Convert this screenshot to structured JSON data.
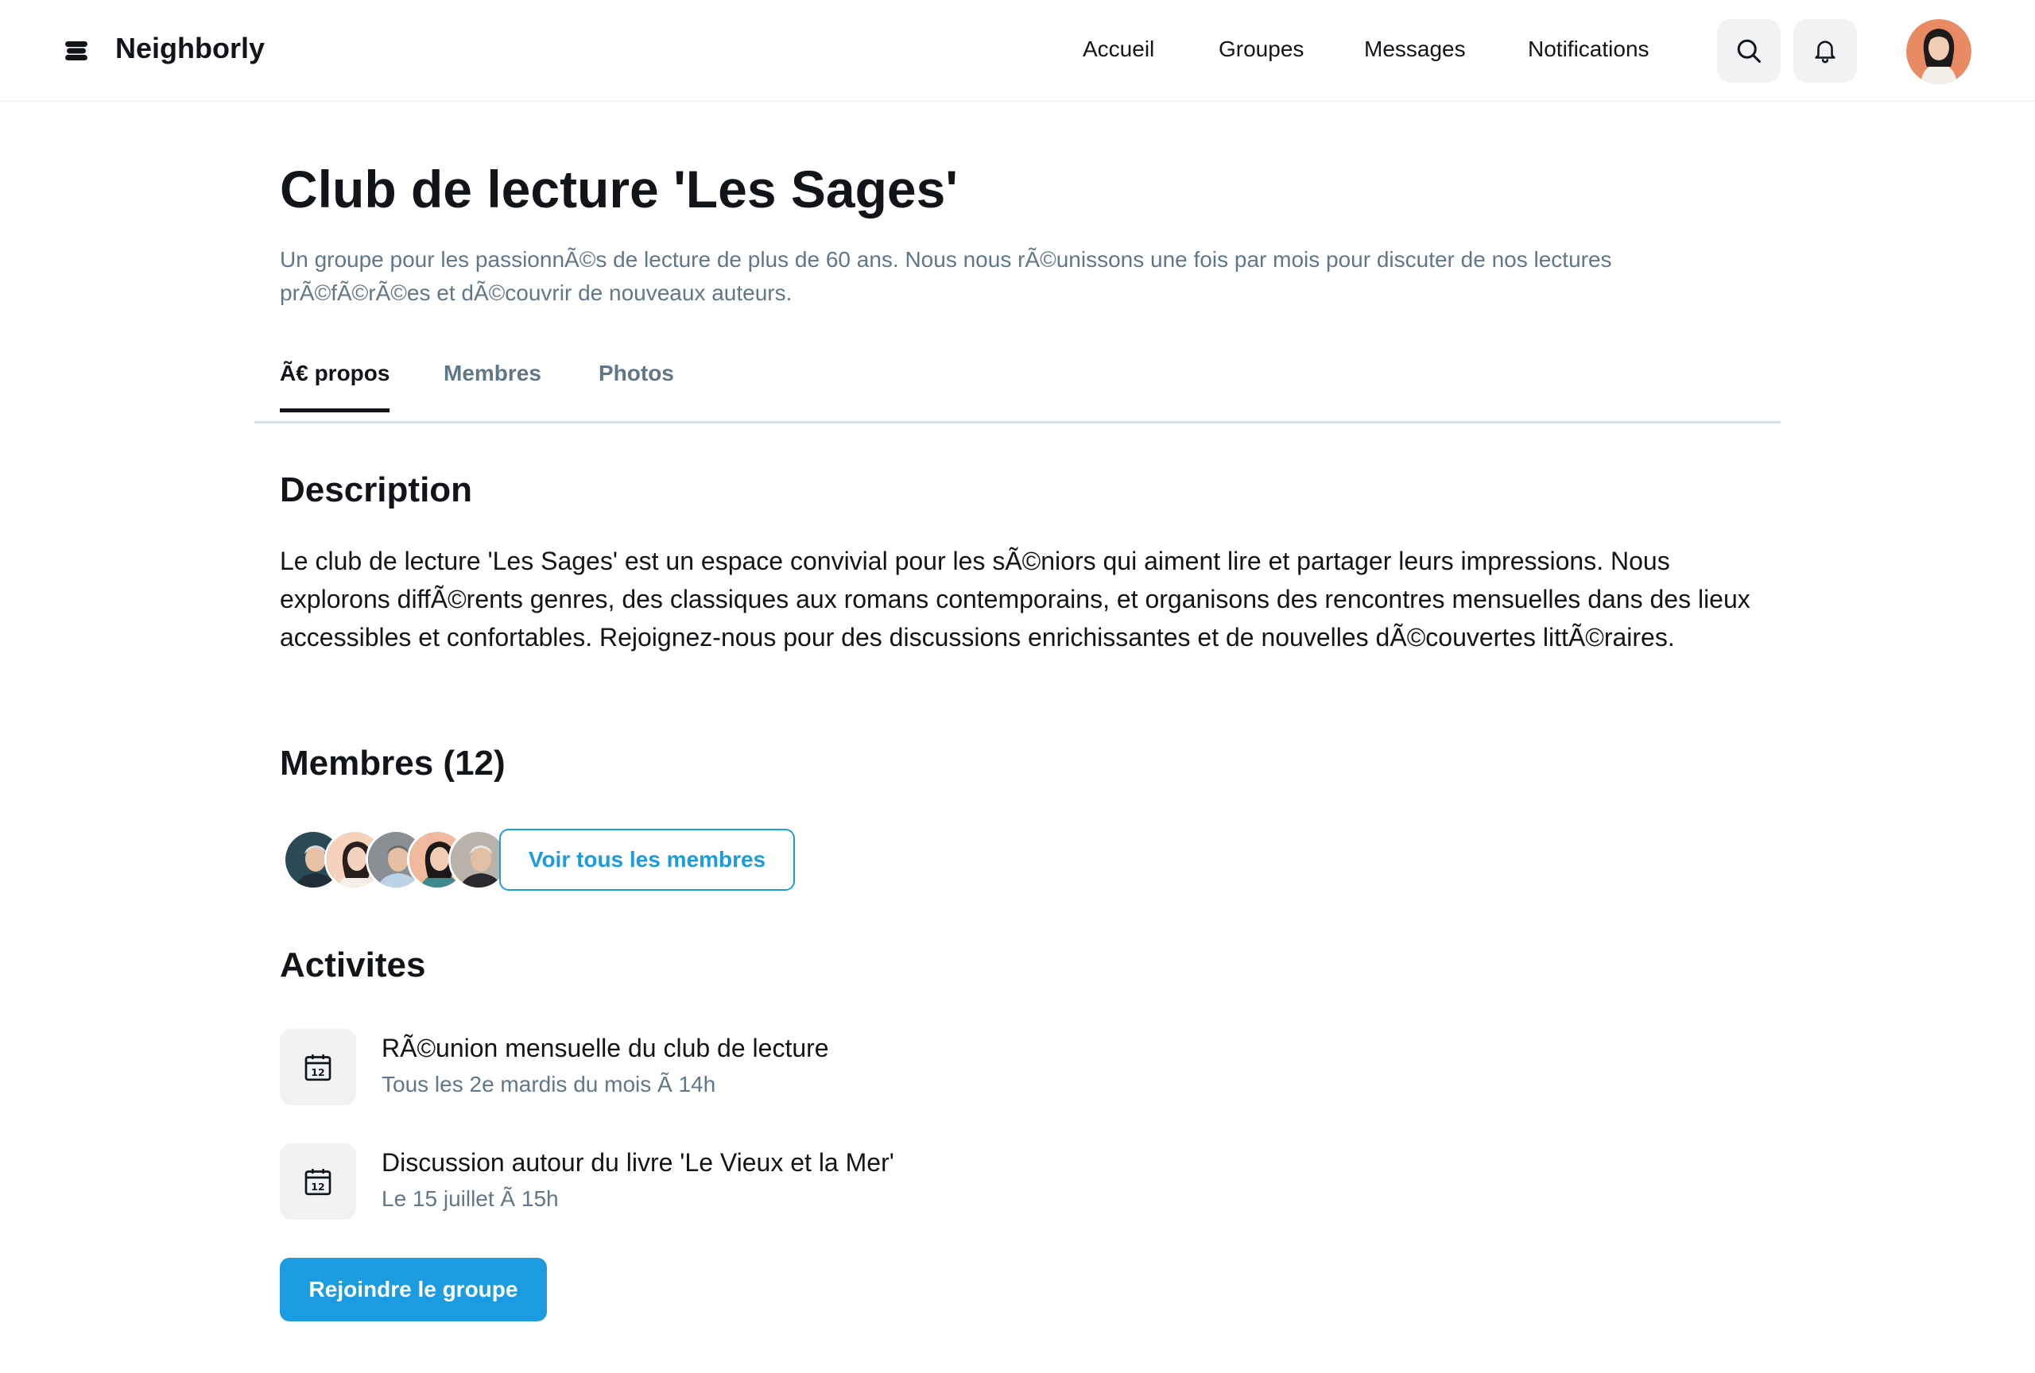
{
  "header": {
    "brand": "Neighborly",
    "nav": [
      "Accueil",
      "Groupes",
      "Messages",
      "Notifications"
    ]
  },
  "group": {
    "title": "Club de lecture 'Les Sages'",
    "subtitle": "Un groupe pour les passionnÃ©s de lecture de plus de 60 ans. Nous nous rÃ©unissons une fois par mois pour discuter de nos lectures prÃ©fÃ©rÃ©es et dÃ©couvrir de nouveaux auteurs."
  },
  "tabs": [
    {
      "label": "Ã€ propos",
      "active": true
    },
    {
      "label": "Membres",
      "active": false
    },
    {
      "label": "Photos",
      "active": false
    }
  ],
  "description": {
    "heading": "Description",
    "text": "Le club de lecture 'Les Sages' est un espace convivial pour les sÃ©niors qui aiment lire et partager leurs impressions. Nous explorons diffÃ©rents genres, des classiques aux romans contemporains, et organisons des rencontres mensuelles dans des lieux accessibles et confortables. Rejoignez-nous pour des discussions enrichissantes et de nouvelles dÃ©couvertes littÃ©raires."
  },
  "members": {
    "heading": "Membres (12)",
    "see_all": "Voir tous les membres"
  },
  "activities": {
    "heading": "Activites",
    "items": [
      {
        "title": "RÃ©union mensuelle du club de lecture",
        "when": "Tous les 2e mardis du mois Ã  14h"
      },
      {
        "title": "Discussion autour du livre 'Le Vieux et la Mer'",
        "when": "Le 15 juillet Ã  15h"
      }
    ]
  },
  "join_button": "Rejoindre le groupe",
  "colors": {
    "accent": "#1c9ce0",
    "muted_text": "#60778a",
    "surface": "#f0f2f4"
  }
}
